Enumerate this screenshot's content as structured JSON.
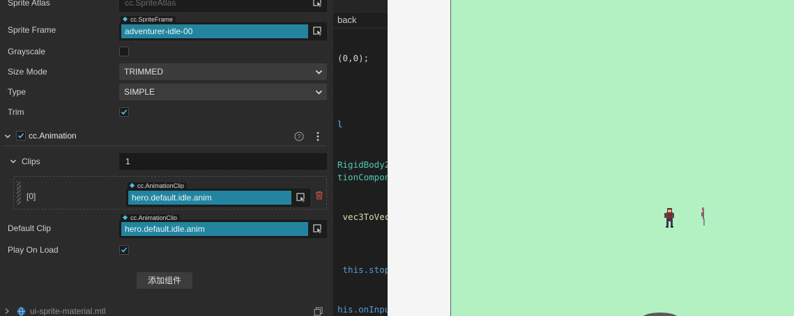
{
  "inspector": {
    "sprite_atlas": {
      "label": "Sprite Atlas",
      "value": "cc.SpriteAtlas"
    },
    "sprite_frame": {
      "label": "Sprite Frame",
      "type_tag": "cc.SpriteFrame",
      "value": "adventurer-idle-00"
    },
    "grayscale": {
      "label": "Grayscale",
      "checked": false
    },
    "size_mode": {
      "label": "Size Mode",
      "value": "TRIMMED"
    },
    "type": {
      "label": "Type",
      "value": "SIMPLE"
    },
    "trim": {
      "label": "Trim",
      "checked": true
    },
    "animation_component": {
      "title": "cc.Animation",
      "enabled": true
    },
    "clips": {
      "label": "Clips",
      "count": "1",
      "items": [
        {
          "index": "[0]",
          "type_tag": "cc.AnimationClip",
          "value": "hero.default.idle.anim"
        }
      ]
    },
    "default_clip": {
      "label": "Default Clip",
      "type_tag": "cc.AnimationClip",
      "value": "hero.default.idle.anim"
    },
    "play_on_load": {
      "label": "Play On Load",
      "checked": true
    },
    "add_component_label": "添加组件",
    "material": {
      "name": "ui-sprite-material.mtl"
    }
  },
  "editor": {
    "tab_label": "back",
    "lines": [
      {
        "text": "(0,0);",
        "color": "#d4d4d4"
      },
      {
        "text": "l",
        "color": "#4fc1ff"
      },
      {
        "text": "RigidBody2",
        "color": "#4ec9b0"
      },
      {
        "text": "tionCompon",
        "color": "#4ec9b0"
      },
      {
        "text": " vec3ToVec",
        "color": "#dcdcaa"
      },
      {
        "text": " this.stop",
        "color": "#569cd6"
      },
      {
        "text": "his.onInpu",
        "color": "#569cd6"
      }
    ]
  },
  "scene": {
    "background": "#b3f0c2",
    "hero_sprite": "adventurer-sprite"
  },
  "colors": {
    "accent": "#23849f",
    "panel": "#2b2b2b"
  }
}
